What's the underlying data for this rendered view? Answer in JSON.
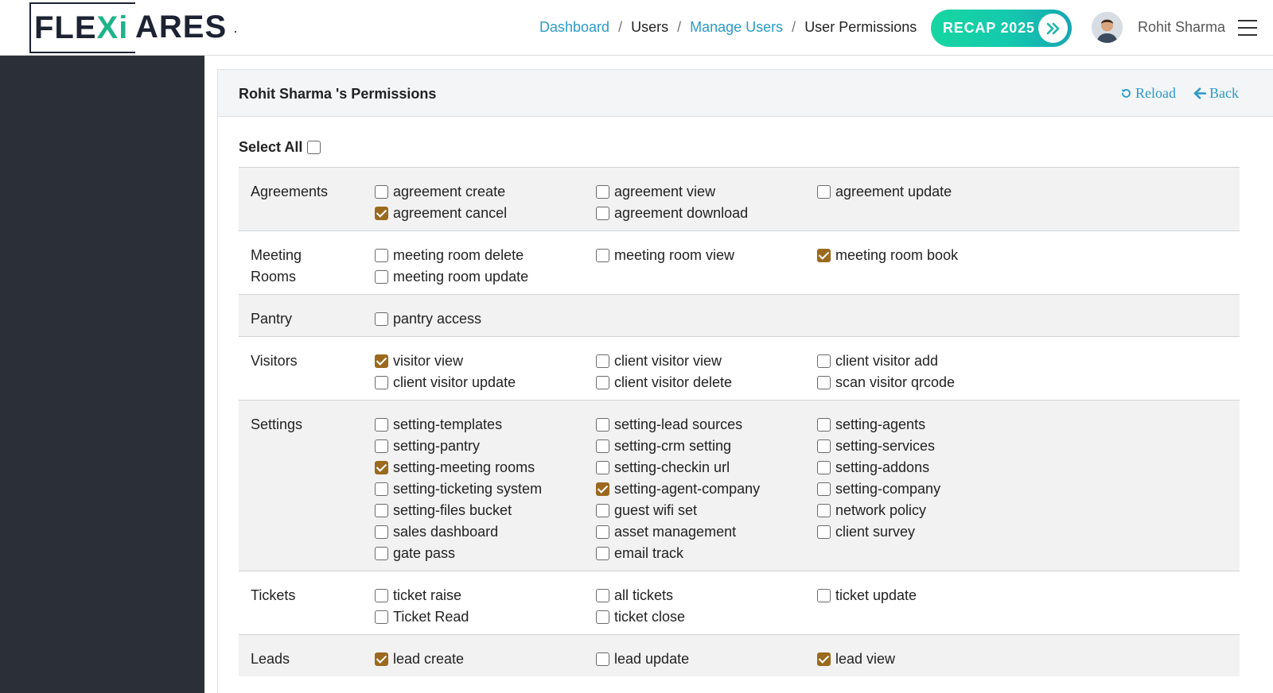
{
  "header": {
    "logo_text_left": "FLE",
    "logo_text_x": "Xi",
    "logo_text_right": "ARES",
    "breadcrumbs": [
      {
        "label": "Dashboard",
        "link": true
      },
      {
        "label": "Users",
        "link": false
      },
      {
        "label": "Manage Users",
        "link": true
      },
      {
        "label": "User Permissions",
        "link": false
      }
    ],
    "breadcrumb_sep": "/",
    "recap_label": "RECAP 2025",
    "user_name": "Rohit Sharma"
  },
  "card": {
    "title": "Rohit Sharma 's Permissions",
    "reload_label": "Reload",
    "back_label": "Back",
    "select_all_label": "Select All",
    "select_all_checked": false
  },
  "groups": [
    {
      "label": "Agreements",
      "items": [
        {
          "label": "agreement create",
          "checked": false
        },
        {
          "label": "agreement view",
          "checked": false
        },
        {
          "label": "agreement update",
          "checked": false
        },
        {
          "label": "agreement cancel",
          "checked": true
        },
        {
          "label": "agreement download",
          "checked": false
        }
      ]
    },
    {
      "label": "Meeting Rooms",
      "items": [
        {
          "label": "meeting room delete",
          "checked": false
        },
        {
          "label": "meeting room view",
          "checked": false
        },
        {
          "label": "meeting room book",
          "checked": true
        },
        {
          "label": "meeting room update",
          "checked": false
        }
      ]
    },
    {
      "label": "Pantry",
      "items": [
        {
          "label": "pantry access",
          "checked": false
        }
      ]
    },
    {
      "label": "Visitors",
      "items": [
        {
          "label": "visitor view",
          "checked": true
        },
        {
          "label": "client visitor view",
          "checked": false
        },
        {
          "label": "client visitor add",
          "checked": false
        },
        {
          "label": "client visitor update",
          "checked": false
        },
        {
          "label": "client visitor delete",
          "checked": false
        },
        {
          "label": "scan visitor qrcode",
          "checked": false
        }
      ]
    },
    {
      "label": "Settings",
      "items": [
        {
          "label": "setting-templates",
          "checked": false
        },
        {
          "label": "setting-lead sources",
          "checked": false
        },
        {
          "label": "setting-agents",
          "checked": false
        },
        {
          "label": "setting-pantry",
          "checked": false
        },
        {
          "label": "setting-crm setting",
          "checked": false
        },
        {
          "label": "setting-services",
          "checked": false
        },
        {
          "label": "setting-meeting rooms",
          "checked": true
        },
        {
          "label": "setting-checkin url",
          "checked": false
        },
        {
          "label": "setting-addons",
          "checked": false
        },
        {
          "label": "setting-ticketing system",
          "checked": false
        },
        {
          "label": "setting-agent-company",
          "checked": true
        },
        {
          "label": "setting-company",
          "checked": false
        },
        {
          "label": "setting-files bucket",
          "checked": false
        },
        {
          "label": "guest wifi set",
          "checked": false
        },
        {
          "label": "network policy",
          "checked": false
        },
        {
          "label": "sales dashboard",
          "checked": false
        },
        {
          "label": "asset management",
          "checked": false
        },
        {
          "label": "client survey",
          "checked": false
        },
        {
          "label": "gate pass",
          "checked": false
        },
        {
          "label": "email track",
          "checked": false
        }
      ]
    },
    {
      "label": "Tickets",
      "items": [
        {
          "label": "ticket raise",
          "checked": false
        },
        {
          "label": "all tickets",
          "checked": false
        },
        {
          "label": "ticket update",
          "checked": false
        },
        {
          "label": "Ticket Read",
          "checked": false
        },
        {
          "label": "ticket close",
          "checked": false
        }
      ]
    },
    {
      "label": "Leads",
      "items": [
        {
          "label": "lead create",
          "checked": true
        },
        {
          "label": "lead update",
          "checked": false
        },
        {
          "label": "lead view",
          "checked": true
        }
      ]
    }
  ],
  "colors": {
    "accent_link": "#2a9bc9",
    "checkbox_checked": "#9b6a1e",
    "sidebar": "#2b3038",
    "recap_start": "#17d6a1",
    "recap_end": "#18a6b3"
  }
}
